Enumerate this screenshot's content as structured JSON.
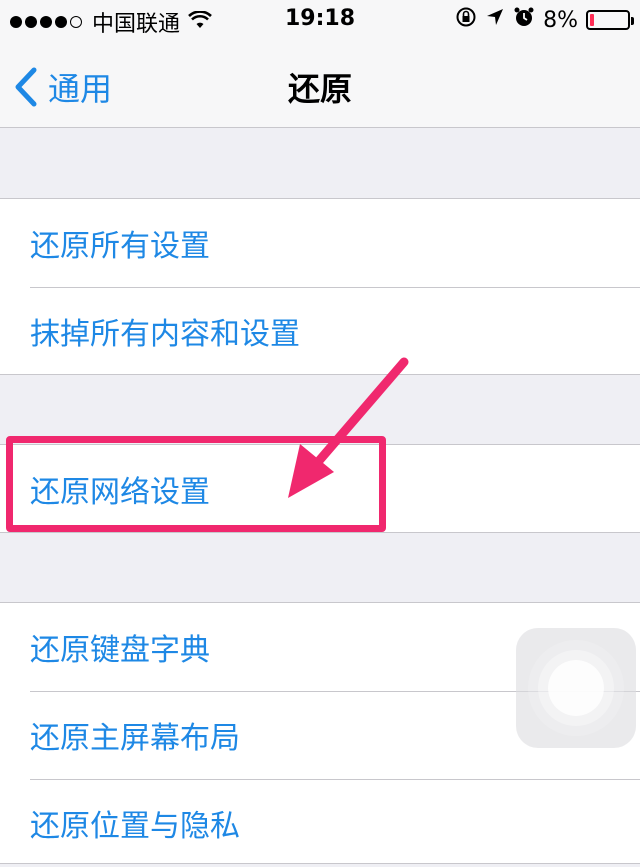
{
  "status_bar": {
    "carrier": "中国联通",
    "time": "19:18",
    "battery_percent": "8%",
    "battery_level": 0.08,
    "battery_color": "#ff2d55",
    "signal_bars": 4
  },
  "nav": {
    "back_label": "通用",
    "title": "还原"
  },
  "groups": [
    {
      "items": [
        {
          "label": "还原所有设置"
        },
        {
          "label": "抹掉所有内容和设置"
        }
      ]
    },
    {
      "items": [
        {
          "label": "还原网络设置"
        }
      ]
    },
    {
      "items": [
        {
          "label": "还原键盘字典"
        },
        {
          "label": "还原主屏幕布局"
        },
        {
          "label": "还原位置与隐私"
        }
      ]
    }
  ],
  "colors": {
    "accent": "#1e88e5",
    "highlight": "#f0286e"
  },
  "icons": [
    "wifi-icon",
    "rotation-lock-icon",
    "location-arrow-icon",
    "alarm-icon",
    "battery-icon",
    "chevron-left-icon",
    "arrow-annotation",
    "assistive-touch-icon"
  ]
}
